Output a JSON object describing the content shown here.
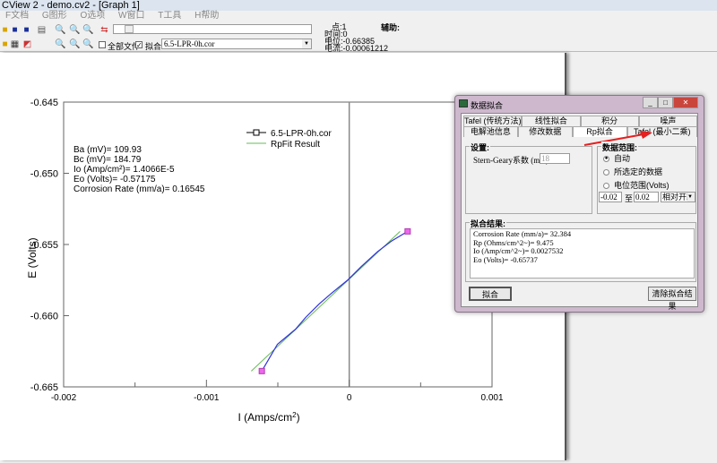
{
  "window": {
    "title": "CView 2 - demo.cv2 - [Graph 1]"
  },
  "menu": [
    "F文档",
    "G图形",
    "O选项",
    "W窗口",
    "T工具",
    "H帮助"
  ],
  "toolbar": {
    "all_files_label": "全部文件",
    "all_files_checked": false,
    "fit_label": "拟合",
    "fit_checked": true,
    "file_select": "6.5-LPR-0h.cor",
    "point_label": "点:1",
    "time_label": "时间:0",
    "potential_label": "电位:-0.66385",
    "current_label": "电流:-0.00061212",
    "aux_label": "辅助:"
  },
  "graph": {
    "annotations": [
      "Ba (mV)= 109.93",
      "Bc (mV)= 184.79",
      "Io (Amp/cm²)= 1.4066E-5",
      "Eo (Volts)= -0.57175",
      "Corrosion Rate (mm/a)= 0.16545"
    ]
  },
  "chart_data": {
    "type": "line",
    "xlabel": "I (Amps/cm²)",
    "ylabel": "E (Volts)",
    "xlim": [
      -0.002,
      0.001
    ],
    "ylim": [
      -0.665,
      -0.645
    ],
    "xticks": [
      "-0.002",
      "-0.001",
      "0",
      "0.001"
    ],
    "xtick_values": [
      -0.002,
      -0.001,
      0,
      0.001
    ],
    "yticks": [
      "-0.645",
      "-0.650",
      "-0.655",
      "-0.660",
      "-0.665"
    ],
    "ytick_values": [
      -0.645,
      -0.65,
      -0.655,
      -0.66,
      -0.665
    ],
    "legend_position": "top-right",
    "series": [
      {
        "name": "6.5-LPR-0h.cor",
        "color": "#3030e0",
        "marker_color": "#ee66ee",
        "x": [
          -0.000612,
          -0.000503,
          -0.000377,
          -0.000304,
          -0.00021,
          -0.000126,
          -1.1e-05,
          8.4e-05,
          0.000199,
          0.000294,
          0.000409
        ],
        "y": [
          -0.66389,
          -0.66201,
          -0.66096,
          -0.66011,
          -0.65917,
          -0.65844,
          -0.6575,
          -0.65655,
          -0.6555,
          -0.65477,
          -0.65408
        ]
      },
      {
        "name": "RpFit Result",
        "color": "#66bb55",
        "x": [
          -0.000686,
          0.000356
        ],
        "y": [
          -0.66389,
          -0.65408
        ]
      }
    ]
  },
  "dialog": {
    "title": "数据拟合",
    "tabs_row1": [
      "Tafel (传统方法)",
      "线性拟合",
      "积分",
      "噪声"
    ],
    "tabs_row2": [
      "电解池信息",
      "修改数据",
      "Rp拟合",
      "Tafel (最小二乘)"
    ],
    "active_tab": "Rp拟合",
    "settings_title": "设置:",
    "stern_geary_label": "Stern-Geary系数 (mV)",
    "stern_geary_value": "18",
    "range_title": "数据范围:",
    "range_options": [
      "自动",
      "所选定的数据",
      "电位范围(Volts)"
    ],
    "range_selected": "自动",
    "range_from": "-0.02",
    "range_to_label": "至",
    "range_to": "0.02",
    "range_mode": "相对开路",
    "results_title": "拟合结果:",
    "results": [
      "Corrosion Rate (mm/a)= 32.384",
      "Rp (Ohms/cm^2~)= 9.475",
      "Io (Amp/cm^2~)= 0.0027532",
      "Eo (Volts)= -0.65737"
    ],
    "fit_button": "拟合",
    "clear_button": "清除拟合结果"
  }
}
